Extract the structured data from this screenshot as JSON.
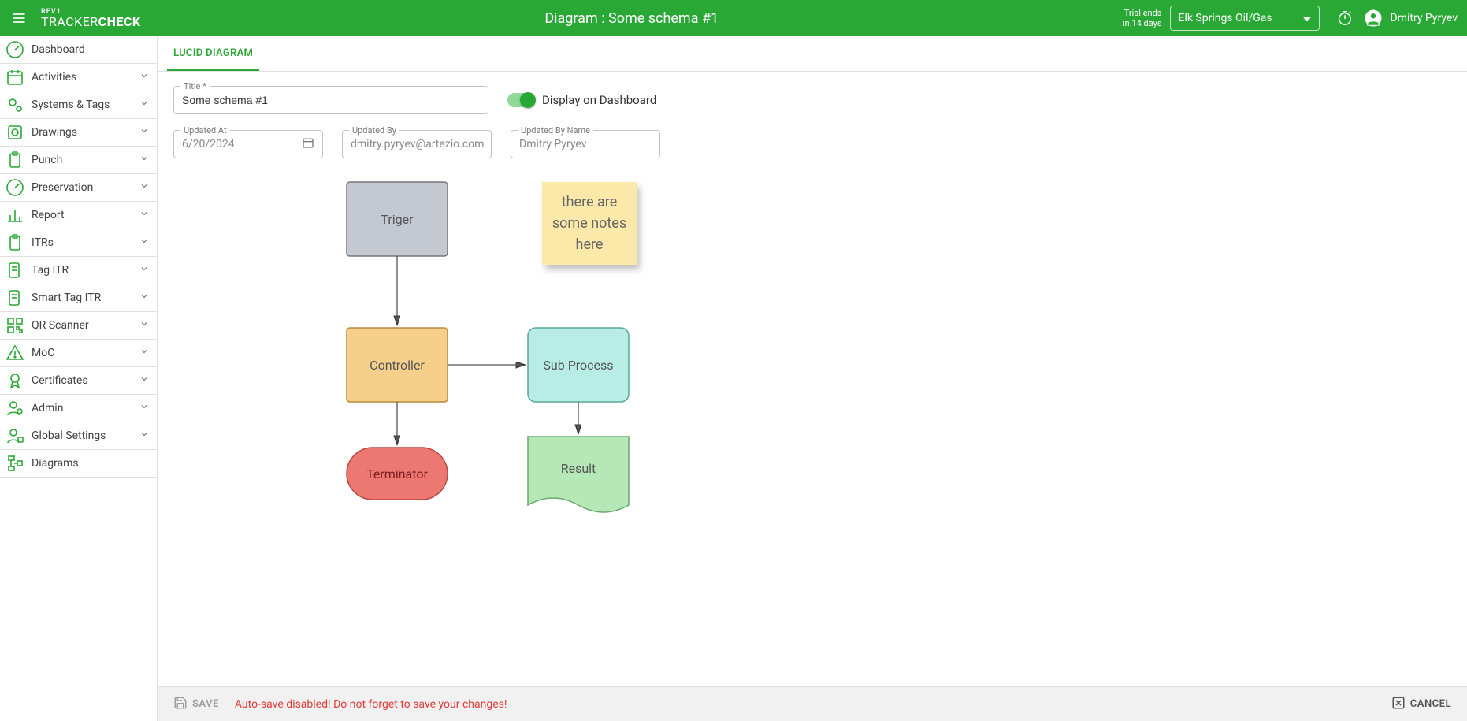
{
  "header": {
    "logo_rev": "REV1",
    "logo_tracker": "TRACKER",
    "logo_check": "CHECK",
    "title": "Diagram : Some schema #1",
    "trial_line1": "Trial ends",
    "trial_line2": "in 14 days",
    "project": "Elk Springs Oil/Gas",
    "user": "Dmitry Pyryev"
  },
  "sidebar": {
    "items": [
      {
        "label": "Dashboard",
        "icon": "speedometer",
        "expandable": false
      },
      {
        "label": "Activities",
        "icon": "calendar",
        "expandable": true
      },
      {
        "label": "Systems & Tags",
        "icon": "gears",
        "expandable": true
      },
      {
        "label": "Drawings",
        "icon": "drawing",
        "expandable": true
      },
      {
        "label": "Punch",
        "icon": "clipboard",
        "expandable": true
      },
      {
        "label": "Preservation",
        "icon": "speedometer",
        "expandable": true
      },
      {
        "label": "Report",
        "icon": "barchart",
        "expandable": true
      },
      {
        "label": "ITRs",
        "icon": "clipboard",
        "expandable": true
      },
      {
        "label": "Tag ITR",
        "icon": "doc-tag",
        "expandable": true
      },
      {
        "label": "Smart Tag ITR",
        "icon": "doc-tag",
        "expandable": true
      },
      {
        "label": "QR Scanner",
        "icon": "qr",
        "expandable": true
      },
      {
        "label": "MoC",
        "icon": "warning",
        "expandable": true
      },
      {
        "label": "Certificates",
        "icon": "badge",
        "expandable": true
      },
      {
        "label": "Admin",
        "icon": "user-admin",
        "expandable": true
      },
      {
        "label": "Global Settings",
        "icon": "user-gear",
        "expandable": true
      },
      {
        "label": "Diagrams",
        "icon": "diagram",
        "expandable": false
      }
    ]
  },
  "tab": {
    "label": "LUCID DIAGRAM"
  },
  "form": {
    "title_label": "Title *",
    "title_value": "Some schema #1",
    "toggle_label": "Display on Dashboard",
    "updated_at_label": "Updated At",
    "updated_at_value": "6/20/2024",
    "updated_by_label": "Updated By",
    "updated_by_value": "dmitry.pyryev@artezio.com",
    "updated_by_name_label": "Updated By Name",
    "updated_by_name_value": "Dmitry Pyryev"
  },
  "diagram": {
    "nodes": {
      "triger": "Triger",
      "note": "there are some notes here",
      "controller": "Controller",
      "subprocess": "Sub Process",
      "terminator": "Terminator",
      "result": "Result"
    }
  },
  "footer": {
    "save": "SAVE",
    "autosave_msg": "Auto-save disabled! Do not forget to save your changes!",
    "cancel": "CANCEL"
  }
}
